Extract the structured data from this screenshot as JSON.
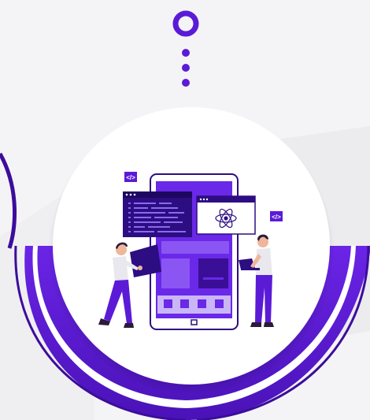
{
  "colors": {
    "background": "#f4f4f6",
    "accent": "#5b1bd6",
    "accent_dark": "#3c0d9b",
    "accent_light": "#7a3ef0",
    "circle": "#ffffff",
    "skin": "#f0b69b",
    "hair": "#2b1b3a",
    "code_panel": "#2d0d82"
  },
  "illustration": {
    "code_badge_text": "</>",
    "react_icon": "react-atom-icon",
    "description_icons": [
      "code-badge-icon",
      "react-atom-icon",
      "phone-home-button-icon"
    ]
  }
}
